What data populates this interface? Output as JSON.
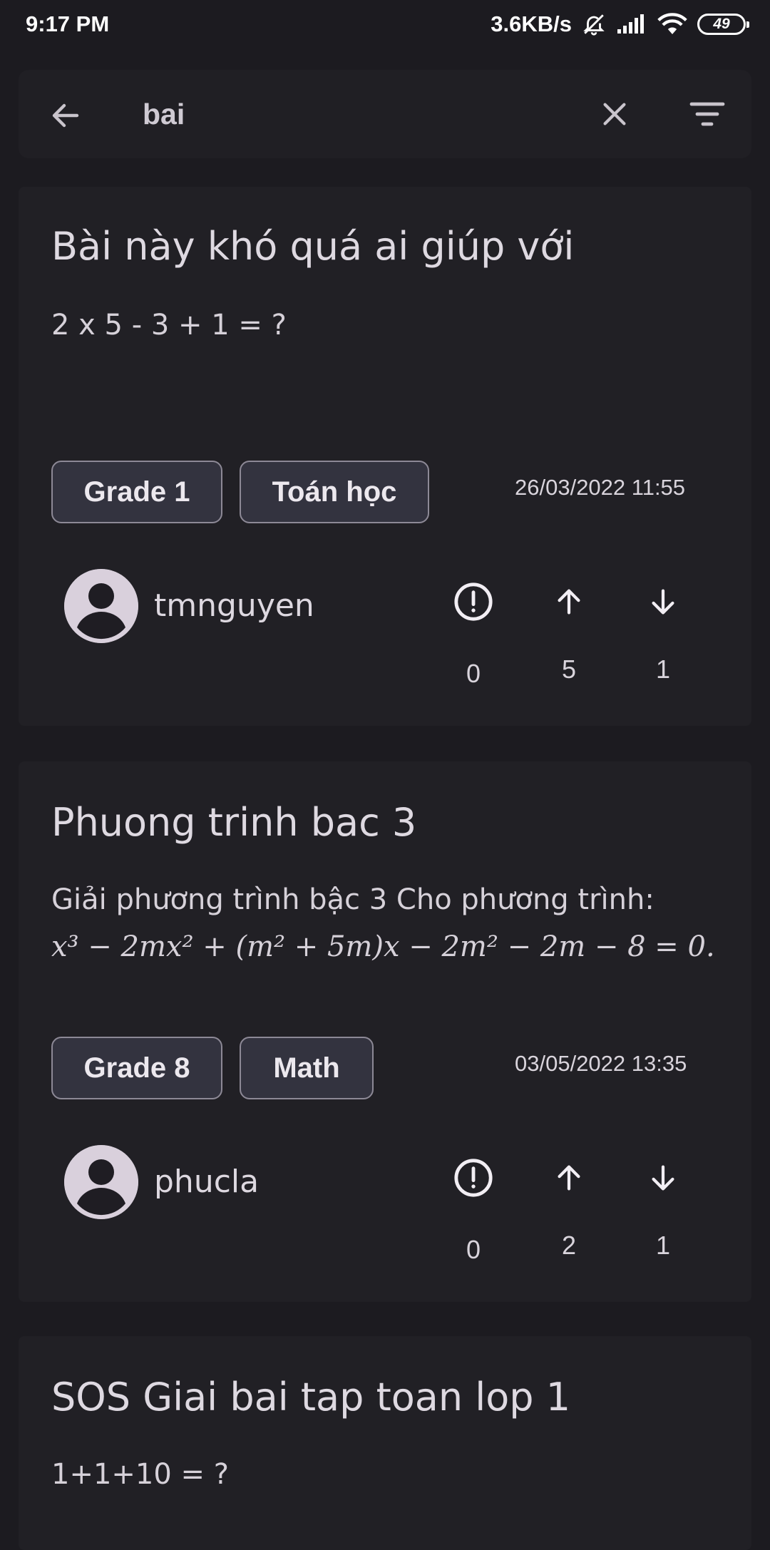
{
  "status_bar": {
    "time": "9:17 PM",
    "network_speed": "3.6KB/s",
    "battery": "49",
    "icons": [
      "mute-bell-icon",
      "signal-icon",
      "wifi-icon",
      "battery-icon"
    ]
  },
  "search": {
    "query": "bai",
    "icons": [
      "back-arrow-icon",
      "close-icon",
      "filter-icon"
    ]
  },
  "posts": [
    {
      "title": "Bài này khó quá ai giúp với",
      "body": "2 x 5 - 3 + 1 = ?",
      "tags": [
        "Grade 1",
        "Toán học"
      ],
      "date": "26/03/2022 11:55",
      "author": "tmnguyen",
      "reports": "0",
      "upvotes": "5",
      "downvotes": "1"
    },
    {
      "title": "Phuong trinh bac 3",
      "body": "Giải phương trình bậc 3 Cho phương trình:",
      "formula": "x³ − 2mx² + (m² + 5m)x − 2m² − 2m − 8 = 0.",
      "tags": [
        "Grade 8",
        "Math"
      ],
      "date": "03/05/2022 13:35",
      "author": "phucla",
      "reports": "0",
      "upvotes": "2",
      "downvotes": "1"
    },
    {
      "title": "SOS Giai bai tap toan lop 1",
      "body": "1+1+10 = ?"
    }
  ],
  "colors": {
    "background": "#1c1b20",
    "card": "#212025",
    "chip": "#33333f",
    "chip_border": "#8d8996",
    "avatar": "#d9d0dc"
  }
}
